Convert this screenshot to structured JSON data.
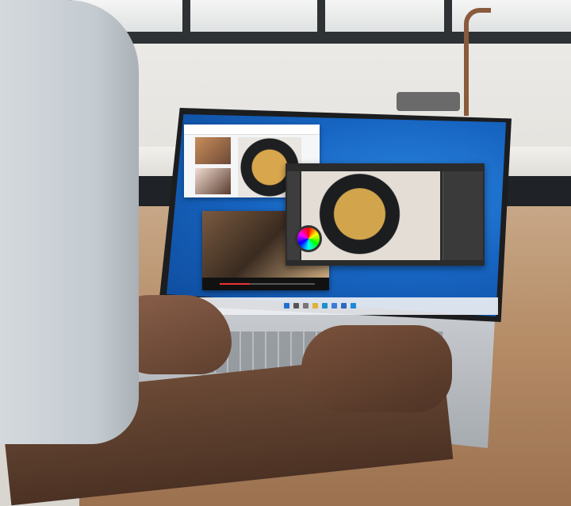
{
  "scene": {
    "description_elements": [
      "kitchen-background",
      "wooden-table",
      "person",
      "laptop"
    ],
    "colors": {
      "desktop_blue": "#1765c2",
      "taskbar": "#ebeef2",
      "video_progress": "#e33333",
      "table_wood": "#b58c66"
    }
  },
  "screen": {
    "windows": [
      {
        "name": "video-call-window",
        "icon": "chat-icon"
      },
      {
        "name": "photo-editor-window",
        "icon": "brush-icon"
      },
      {
        "name": "video-player-window",
        "icon": "play-icon"
      }
    ],
    "video_progress": 0.32,
    "taskbar_icons": [
      "start-icon",
      "search-icon",
      "taskview-icon",
      "folder-icon",
      "edge-icon",
      "store-icon",
      "mail-icon",
      "photos-icon"
    ]
  }
}
